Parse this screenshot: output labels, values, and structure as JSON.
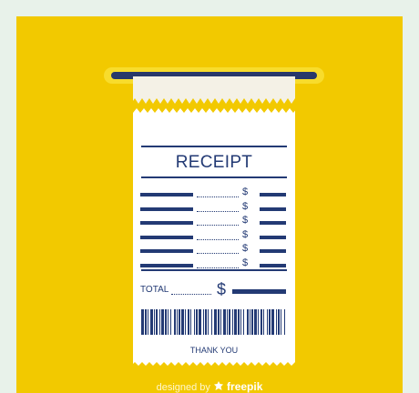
{
  "receipt": {
    "title": "RECEIPT",
    "line_currency": "$",
    "line_count": 6,
    "total_label": "TOTAL",
    "total_currency": "$",
    "thanks": "THANK YOU"
  },
  "credit": {
    "prefix": "designed by",
    "brand": "freepik",
    "logo_icon": "freepik-logo-icon"
  },
  "colors": {
    "background": "#f2c900",
    "ink": "#233a74",
    "paper": "#ffffff",
    "slot": "#28386a",
    "slot_rim": "#f8dc2c",
    "outer": "#e8f2ea"
  }
}
